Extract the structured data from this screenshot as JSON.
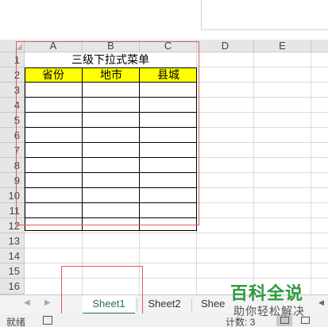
{
  "columns": [
    "A",
    "B",
    "C",
    "D",
    "E"
  ],
  "rows": [
    "1",
    "2",
    "3",
    "4",
    "5",
    "6",
    "7",
    "8",
    "9",
    "10",
    "11",
    "12",
    "13",
    "14",
    "15",
    "16"
  ],
  "table": {
    "title": "三级下拉式菜单",
    "headers": [
      "省份",
      "地市",
      "县城"
    ],
    "header_fill": "#ffff00"
  },
  "sheet_tabs": [
    "Sheet1",
    "Sheet2",
    "Shee"
  ],
  "active_tab": "Sheet1",
  "status": {
    "ready": "就绪",
    "count": "计数: 3"
  },
  "watermark": {
    "title": "百科全说",
    "subtitle": "助你轻松解决"
  },
  "colors": {
    "highlight_frame": "#e05a5a",
    "active_tab_accent": "#217346",
    "watermark_green": "#2e9a3f"
  }
}
